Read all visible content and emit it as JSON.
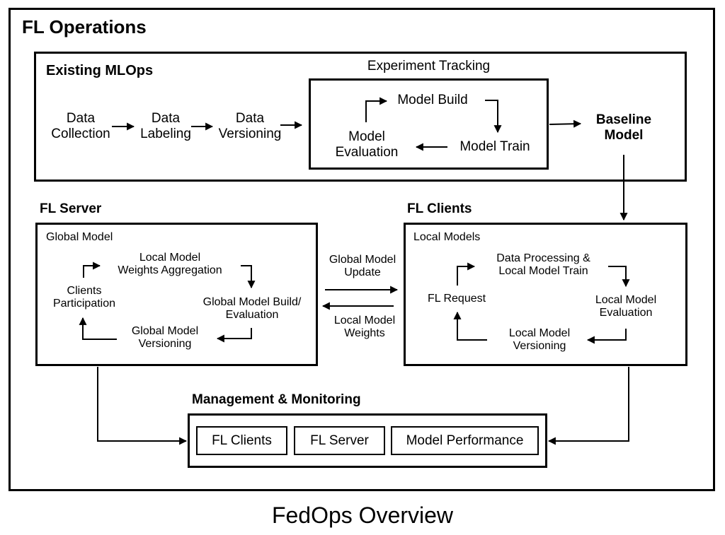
{
  "title": "FL Operations",
  "caption": "FedOps Overview",
  "existing_mlops": {
    "label": "Existing MLOps",
    "steps": [
      {
        "line1": "Data",
        "line2": "Collection"
      },
      {
        "line1": "Data",
        "line2": "Labeling"
      },
      {
        "line1": "Data",
        "line2": "Versioning"
      }
    ],
    "experiment_tracking": {
      "label": "Experiment Tracking",
      "model_build": "Model Build",
      "model_train": "Model Train",
      "model_evaluation": {
        "line1": "Model",
        "line2": "Evaluation"
      }
    },
    "baseline_model": {
      "line1": "Baseline",
      "line2": "Model"
    }
  },
  "fl_server": {
    "label": "FL Server",
    "inner_label": "Global Model",
    "aggregation": {
      "line1": "Local Model",
      "line2": "Weights Aggregation"
    },
    "build_eval": {
      "line1": "Global Model Build/",
      "line2": "Evaluation"
    },
    "versioning": {
      "line1": "Global Model",
      "line2": "Versioning"
    },
    "participation": {
      "line1": "Clients",
      "line2": "Participation"
    }
  },
  "exchange": {
    "global_update": {
      "line1": "Global Model",
      "line2": "Update"
    },
    "local_weights": {
      "line1": "Local Model",
      "line2": "Weights"
    }
  },
  "fl_clients": {
    "label": "FL Clients",
    "inner_label": "Local Models",
    "train": {
      "line1": "Data Processing &",
      "line2": "Local Model Train"
    },
    "evaluation": {
      "line1": "Local Model",
      "line2": "Evaluation"
    },
    "versioning": {
      "line1": "Local Model",
      "line2": "Versioning"
    },
    "request": "FL Request"
  },
  "management": {
    "label": "Management & Monitoring",
    "items": [
      "FL Clients",
      "FL Server",
      "Model Performance"
    ]
  }
}
